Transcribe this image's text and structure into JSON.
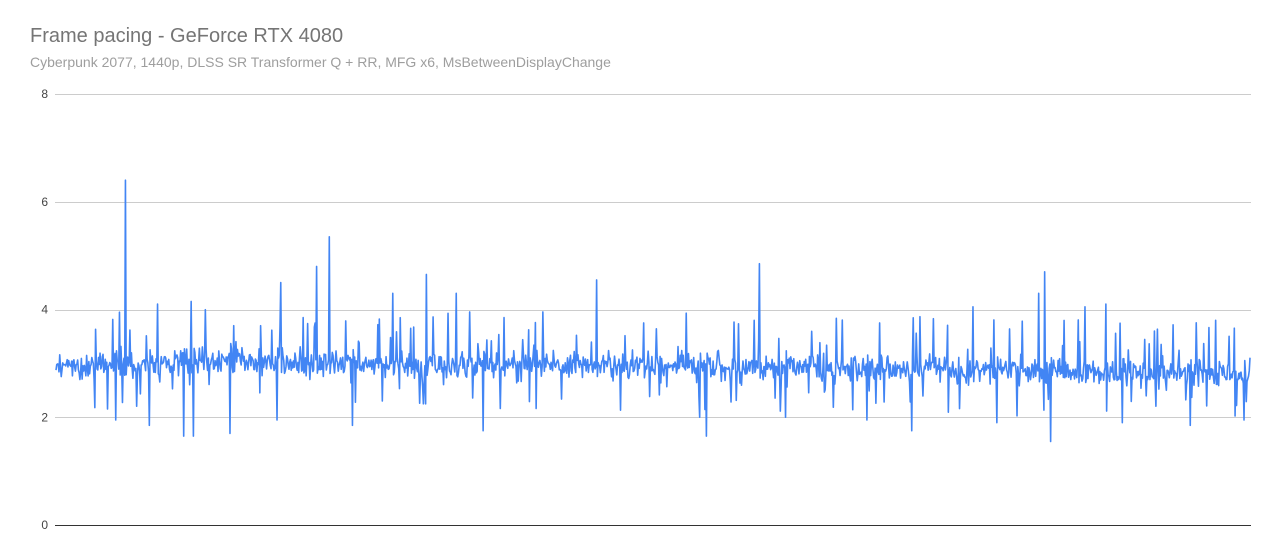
{
  "chart_data": {
    "type": "line",
    "title": "Frame pacing - GeForce RTX 4080",
    "subtitle": "Cyberpunk 2077, 1440p, DLSS SR Transformer Q + RR, MFG x6, MsBetweenDisplayChange",
    "xlabel": "",
    "ylabel": "",
    "ylim": [
      0,
      8
    ],
    "yticks": [
      0,
      2,
      4,
      6,
      8
    ],
    "grid": true,
    "legend": "none",
    "series_color": "#4285f4",
    "series": [
      {
        "sample_count": 1600,
        "baseline": [
          [
            0,
            2.95
          ],
          [
            0.15,
            3.05
          ],
          [
            0.3,
            2.98
          ],
          [
            0.5,
            2.95
          ],
          [
            0.7,
            2.9
          ],
          [
            0.85,
            2.85
          ],
          [
            1,
            2.8
          ]
        ],
        "spikes": [
          [
            0.058,
            6.4
          ],
          [
            0.113,
            4.15
          ],
          [
            0.188,
            4.5
          ],
          [
            0.218,
            4.8
          ],
          [
            0.229,
            5.35
          ],
          [
            0.282,
            4.3
          ],
          [
            0.31,
            4.65
          ],
          [
            0.335,
            4.3
          ],
          [
            0.453,
            4.55
          ],
          [
            0.589,
            4.85
          ],
          [
            0.768,
            4.05
          ],
          [
            0.823,
            4.3
          ],
          [
            0.828,
            4.7
          ],
          [
            0.862,
            4.05
          ],
          [
            0.879,
            4.1
          ],
          [
            0.085,
            4.1
          ],
          [
            0.053,
            3.95
          ],
          [
            0.149,
            3.7
          ],
          [
            0.207,
            3.85
          ],
          [
            0.375,
            3.85
          ],
          [
            0.492,
            3.75
          ],
          [
            0.69,
            3.75
          ],
          [
            0.92,
            3.6
          ],
          [
            0.971,
            3.8
          ]
        ],
        "dips": [
          [
            0.05,
            1.95
          ],
          [
            0.078,
            1.85
          ],
          [
            0.107,
            1.65
          ],
          [
            0.115,
            1.65
          ],
          [
            0.146,
            1.7
          ],
          [
            0.185,
            1.95
          ],
          [
            0.248,
            1.85
          ],
          [
            0.358,
            1.75
          ],
          [
            0.539,
            2.0
          ],
          [
            0.545,
            1.65
          ],
          [
            0.611,
            2.0
          ],
          [
            0.679,
            1.95
          ],
          [
            0.717,
            1.75
          ],
          [
            0.788,
            1.9
          ],
          [
            0.833,
            1.55
          ],
          [
            0.893,
            1.9
          ],
          [
            0.95,
            1.85
          ],
          [
            0.995,
            1.95
          ]
        ]
      }
    ]
  }
}
